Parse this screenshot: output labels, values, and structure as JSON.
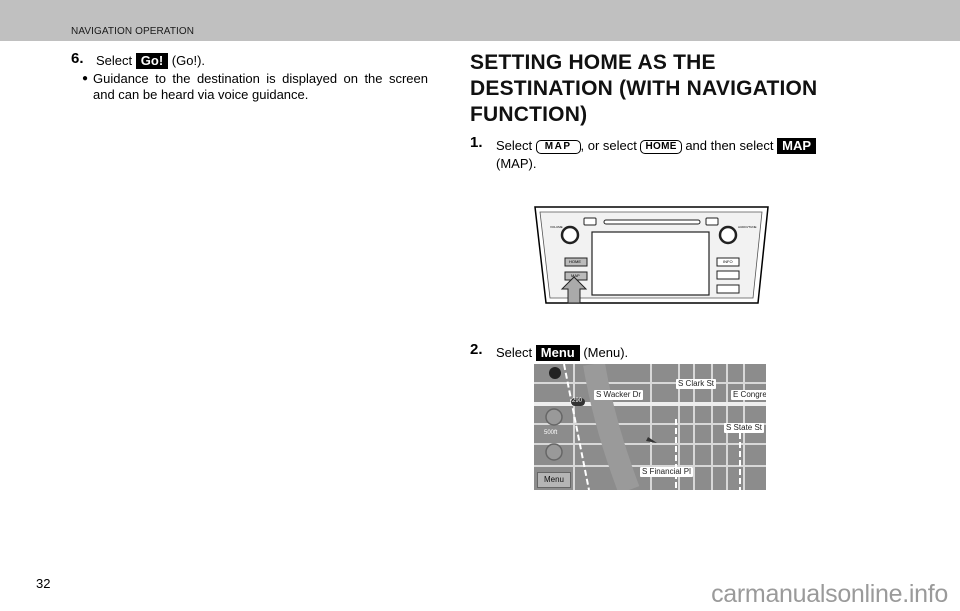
{
  "header": {
    "section_title": "NAVIGATION OPERATION"
  },
  "left_column": {
    "step6": {
      "number": "6.",
      "prefix": "Select",
      "chip": "Go!",
      "suffix": "(Go!).",
      "bullet": "Guidance to the destination is displayed on the screen and can be heard via voice guidance."
    }
  },
  "right_column": {
    "heading_lines": [
      "SETTING HOME AS THE",
      "DESTINATION (WITH NAVIGATION",
      "FUNCTION)"
    ],
    "step1": {
      "number": "1.",
      "prefix": "Select",
      "chip_map_outline": "MAP",
      "middle": ", or select",
      "chip_home_outline": "HOME",
      "middle2": "and then select",
      "chip_map_black": "MAP",
      "suffix": "(MAP)."
    },
    "headunit": {
      "volume_label": "VOLUME",
      "audio_tune_label": "AUDIO/TUNE",
      "home_button": "HOME",
      "map_button": "MAP",
      "info_button": "INFO"
    },
    "step2": {
      "number": "2.",
      "prefix": "Select",
      "chip": "Menu",
      "suffix": "(Menu)."
    },
    "map": {
      "streets": [
        "S Wacker Dr",
        "S Clark St",
        "E Congre",
        "S State St",
        "S Financial Pl"
      ],
      "highway_shield": "290",
      "scale": "500ft",
      "menu_button": "Menu"
    }
  },
  "footer": {
    "page_number": "32",
    "watermark": "carmanualsonline.info"
  }
}
